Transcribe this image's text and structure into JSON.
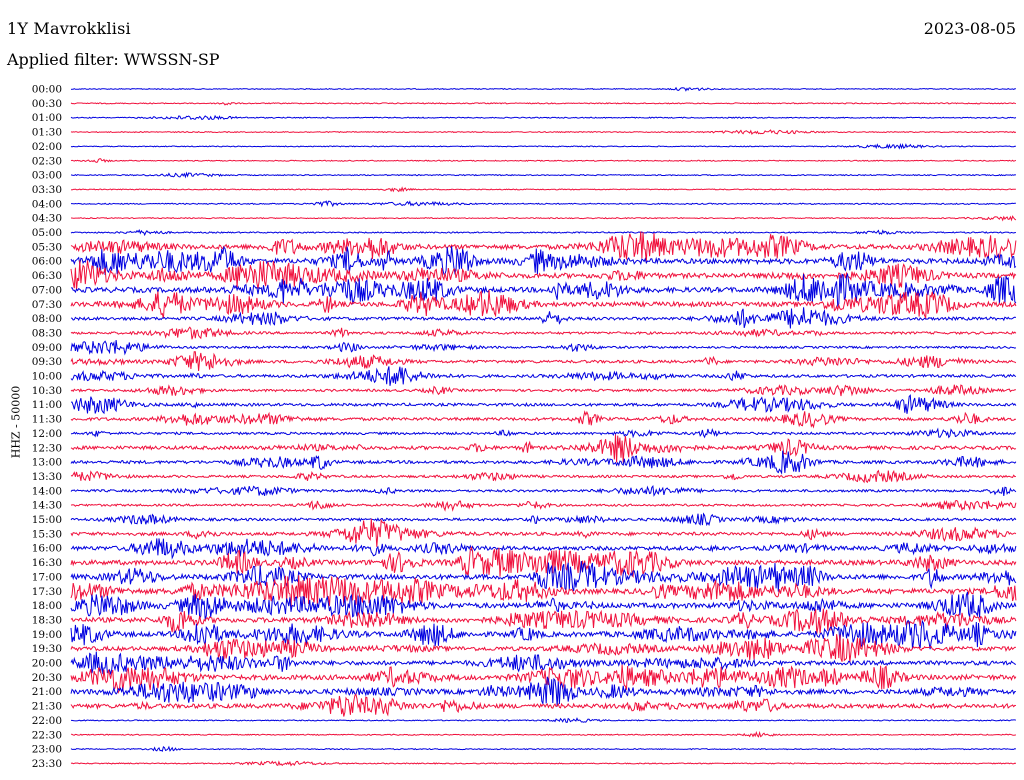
{
  "header": {
    "station": "1Y Mavrokklisi",
    "date": "2023-08-05",
    "filter": "Applied filter: WWSSN-SP",
    "channel": "HHZ - 50000"
  },
  "colors": {
    "trace_a": "#0000e0",
    "trace_b": "#f0103c",
    "background": "#ffffff",
    "text": "#000000"
  },
  "chart_data": {
    "type": "helicorder",
    "title": "1Y Mavrokklisi",
    "subtitle": "Applied filter: WWSSN-SP",
    "ylabel": "HHZ - 50000",
    "xlabel": "",
    "date": "2023-08-05",
    "row_interval_minutes": 30,
    "row_labels": [
      "00:00",
      "00:30",
      "01:00",
      "01:30",
      "02:00",
      "02:30",
      "03:00",
      "03:30",
      "04:00",
      "04:30",
      "05:00",
      "05:30",
      "06:00",
      "06:30",
      "07:00",
      "07:30",
      "08:00",
      "08:30",
      "09:00",
      "09:30",
      "10:00",
      "10:30",
      "11:00",
      "11:30",
      "12:00",
      "12:30",
      "13:00",
      "13:30",
      "14:00",
      "14:30",
      "15:00",
      "15:30",
      "16:00",
      "16:30",
      "17:00",
      "17:30",
      "18:00",
      "18:30",
      "19:00",
      "19:30",
      "20:00",
      "20:30",
      "21:00",
      "21:30",
      "22:00",
      "22:30",
      "23:00",
      "23:30"
    ],
    "series": [
      {
        "color": "#0000e0",
        "rows": "even (00:00, 01:00, ...)"
      },
      {
        "color": "#f0103c",
        "rows": "odd (00:30, 01:30, ...)"
      }
    ],
    "activity_level": [
      0.02,
      0.05,
      0.04,
      0.03,
      0.02,
      0.03,
      0.05,
      0.03,
      0.08,
      0.03,
      0.1,
      0.85,
      0.95,
      0.9,
      0.95,
      0.85,
      0.5,
      0.35,
      0.3,
      0.45,
      0.45,
      0.35,
      0.45,
      0.5,
      0.35,
      0.6,
      0.5,
      0.35,
      0.35,
      0.3,
      0.4,
      0.55,
      0.7,
      0.85,
      0.9,
      0.95,
      0.95,
      0.9,
      0.9,
      0.75,
      0.75,
      0.9,
      0.85,
      0.8,
      0.05,
      0.05,
      0.04,
      0.05
    ],
    "grid": false
  }
}
